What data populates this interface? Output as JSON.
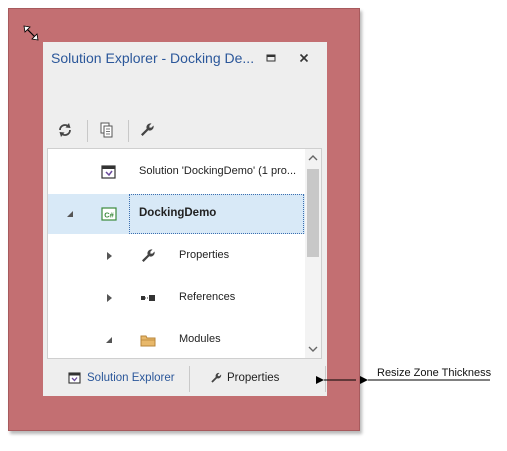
{
  "colors": {
    "resize_zone": "#c36f72",
    "panel_background": "#eeeeee",
    "caption_text": "#2b579a",
    "selection": "#d8e9f7",
    "selection_border": "#3c6fb0"
  },
  "window": {
    "title": "Solution Explorer - Docking De...",
    "buttons": [
      {
        "name": "maximize",
        "icon": "maximize-icon"
      },
      {
        "name": "close",
        "icon": "close-icon"
      }
    ]
  },
  "toolbar": {
    "items": [
      {
        "name": "sync-with-active-document",
        "icon": "sync-icon"
      },
      {
        "name": "show-all-files",
        "icon": "show-all-files-icon"
      },
      {
        "name": "properties",
        "icon": "wrench-icon"
      }
    ]
  },
  "tree": {
    "rows": [
      {
        "label": "Solution 'DockingDemo' (1 pro...",
        "icon": "solution-icon",
        "expander": "none",
        "selected": false
      },
      {
        "label": "DockingDemo",
        "icon": "csharp-project-icon",
        "expander": "expanded",
        "selected": true
      },
      {
        "label": "Properties",
        "icon": "wrench-icon",
        "expander": "collapsed",
        "selected": false
      },
      {
        "label": "References",
        "icon": "references-icon",
        "expander": "collapsed",
        "selected": false
      },
      {
        "label": "Modules",
        "icon": "folder-icon",
        "expander": "expanded",
        "selected": false
      }
    ]
  },
  "tabs": [
    {
      "label": "Solution Explorer",
      "icon": "solution-explorer-icon",
      "active": true
    },
    {
      "label": "Properties",
      "icon": "wrench-icon",
      "active": false
    }
  ],
  "annotation": {
    "text": "Resize Zone Thickness"
  }
}
